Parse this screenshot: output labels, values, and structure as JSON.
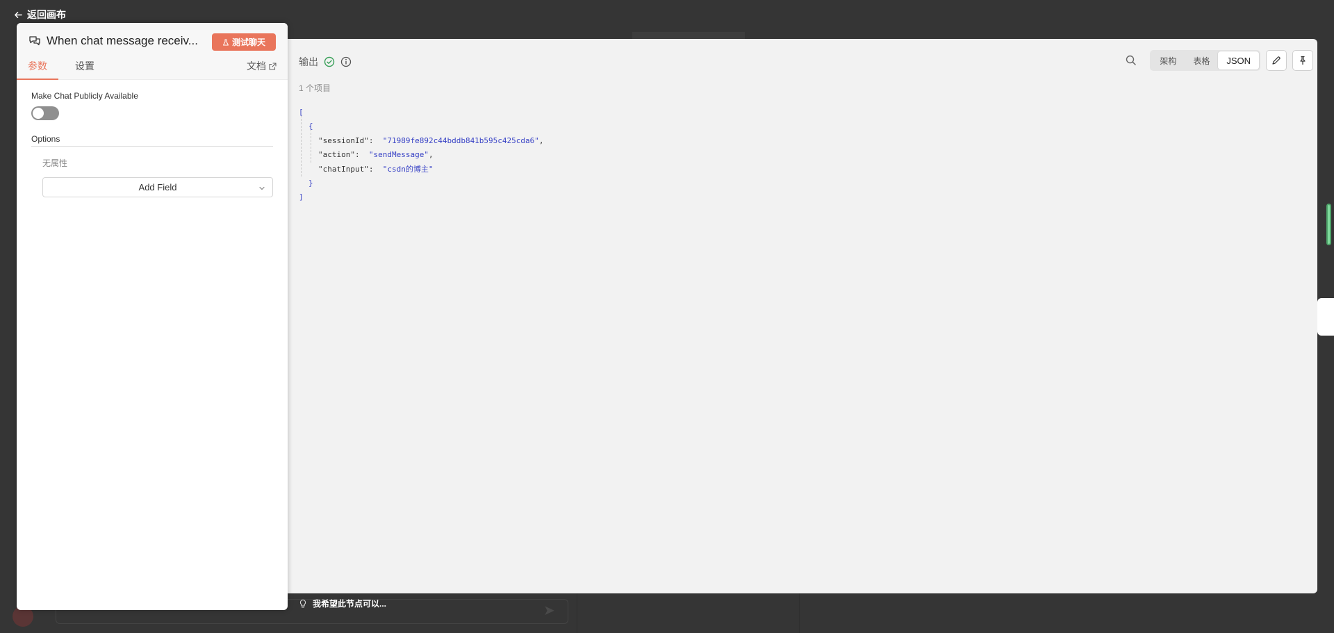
{
  "nav": {
    "back_label": "返回画布"
  },
  "node": {
    "title": "When chat message receiv...",
    "test_button_label": "测试聊天",
    "tabs": [
      {
        "label": "参数",
        "active": true
      },
      {
        "label": "设置",
        "active": false
      }
    ],
    "docs_label": "文档",
    "fields": {
      "public_label": "Make Chat Publicly Available",
      "public_enabled": false,
      "options_title": "Options",
      "no_properties": "无属性",
      "add_field_label": "Add Field"
    }
  },
  "output": {
    "title": "输出",
    "item_count": "1 个项目",
    "views": [
      {
        "label": "架构",
        "active": false
      },
      {
        "label": "表格",
        "active": false
      },
      {
        "label": "JSON",
        "active": true
      }
    ],
    "json": {
      "open_bracket": "[",
      "open_brace": "{",
      "entries": [
        {
          "key": "\"sessionId\"",
          "value": "\"71989fe892c44bddb841b595c425cda6\"",
          "trailing": ","
        },
        {
          "key": "\"action\"",
          "value": "\"sendMessage\"",
          "trailing": ","
        },
        {
          "key": "\"chatInput\"",
          "value": "\"csdn的博主\"",
          "trailing": ""
        }
      ],
      "close_brace": "}",
      "close_bracket": "]"
    }
  },
  "prompt": {
    "hint": "我希望此节点可以..."
  },
  "colors": {
    "accent": "#e9755b",
    "success": "#3aa05a",
    "json_string": "#3a44c6"
  }
}
